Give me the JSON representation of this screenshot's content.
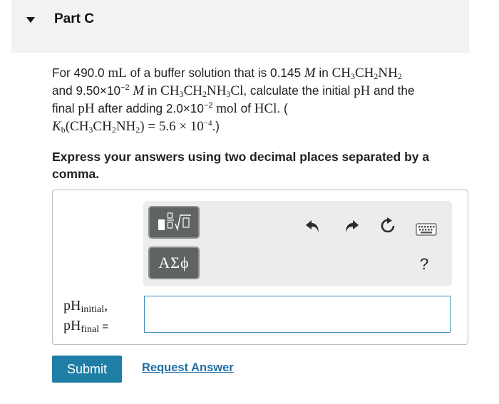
{
  "part": {
    "title": "Part C"
  },
  "question": {
    "t_for": "For 490.0 ",
    "u_ml": "mL",
    "t_buffer": " of a buffer solution that is 0.145 ",
    "sym_M": "M",
    "t_in": " in ",
    "t_and": "and 9.50×10",
    "exp_neg2": "−2",
    "t_sp": " ",
    "t_in2": " in ",
    "t_calc": ", calculate the initial ",
    "sym_pH": "pH",
    "t_andthe": " and the",
    "t_final": "final ",
    "t_after": " after adding 2.0×10",
    "u_mol": "mol",
    "t_of": " of ",
    "hcl": "HCl",
    "t_dotparen": ". (",
    "kb_K": "K",
    "kb_sub": "b",
    "kb_eq": ") = 5.6 × 10",
    "kb_exp": "−4",
    "t_end": ".)",
    "f_CH": "CH",
    "f_NH": "NH",
    "f_Cl": "Cl",
    "n2": "2",
    "n3": "3"
  },
  "instruction": "Express your answers using two decimal places separated by a comma.",
  "toolbar": {
    "symbols_label": "ΑΣϕ",
    "help_label": "?",
    "icons": [
      "templates-icon",
      "undo-icon",
      "redo-icon",
      "reset-icon",
      "keyboard-icon"
    ]
  },
  "answer": {
    "label_ph": "pH",
    "label_initial": "initial",
    "label_comma": ",",
    "label_final": "final",
    "label_eq": " =",
    "value": ""
  },
  "actions": {
    "submit": "Submit",
    "request_answer": "Request Answer"
  },
  "colors": {
    "header_bg": "#f2f2f2",
    "submit_bg": "#1f7ea5",
    "link": "#1f6fa3",
    "input_border": "#3a8bb9",
    "tool_button": "#5f6364"
  }
}
